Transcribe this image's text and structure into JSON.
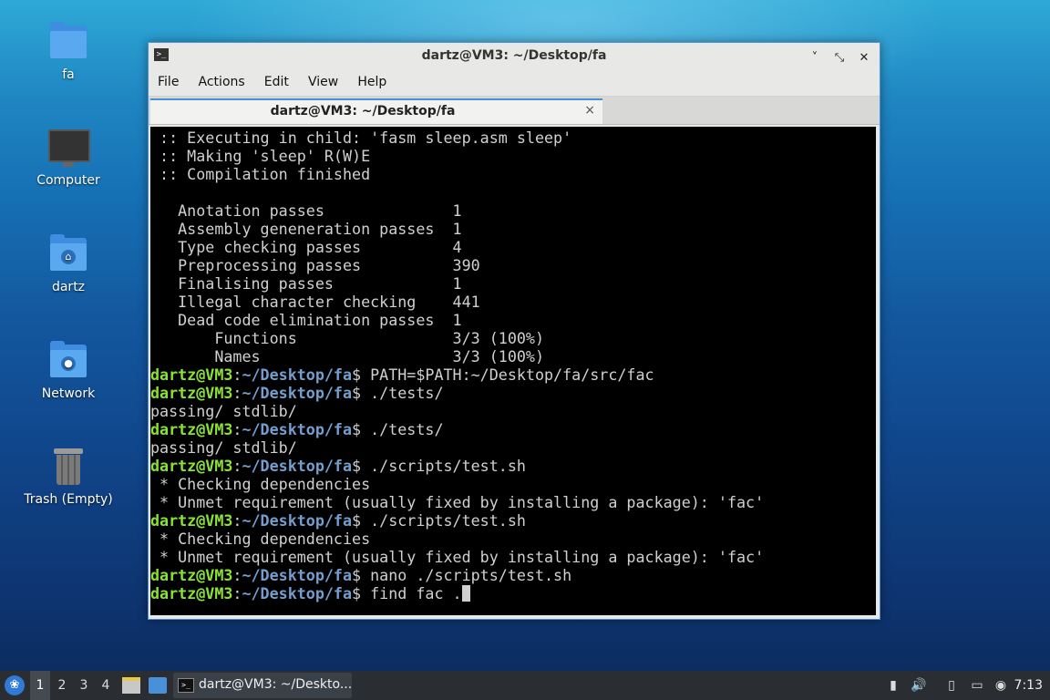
{
  "desktop": {
    "icons": [
      {
        "label": "fa",
        "icon": "folder-icon"
      },
      {
        "label": "Computer",
        "icon": "computer-icon"
      },
      {
        "label": "dartz",
        "icon": "home-folder-icon"
      },
      {
        "label": "Network",
        "icon": "network-folder-icon"
      },
      {
        "label": "Trash (Empty)",
        "icon": "trash-icon"
      }
    ]
  },
  "window": {
    "title": "dartz@VM3: ~/Desktop/fa",
    "menu": [
      "File",
      "Actions",
      "Edit",
      "View",
      "Help"
    ],
    "tab_label": "dartz@VM3: ~/Desktop/fa",
    "tab_close": "×",
    "buttons": {
      "minimize": "˅",
      "maximize": "⤡",
      "close": "✕"
    }
  },
  "terminal": {
    "prompt_user": "dartz@VM3",
    "prompt_sep": ":",
    "prompt_path": "~/Desktop/fa",
    "prompt_dollar": "$ ",
    "lines": [
      {
        "text": " :: Executing in child: 'fasm sleep.asm sleep'"
      },
      {
        "text": " :: Making 'sleep' R(W)E"
      },
      {
        "text": " :: Compilation finished"
      },
      {
        "text": ""
      },
      {
        "text": "   Anotation passes              1"
      },
      {
        "text": "   Assembly geneneration passes  1"
      },
      {
        "text": "   Type checking passes          4"
      },
      {
        "text": "   Preprocessing passes          390"
      },
      {
        "text": "   Finalising passes             1"
      },
      {
        "text": "   Illegal character checking    441"
      },
      {
        "text": "   Dead code elimination passes  1"
      },
      {
        "text": "       Functions                 3/3 (100%)"
      },
      {
        "text": "       Names                     3/3 (100%)"
      },
      {
        "cmd": "PATH=$PATH:~/Desktop/fa/src/fac"
      },
      {
        "cmd": "./tests/"
      },
      {
        "text": "passing/ stdlib/"
      },
      {
        "cmd": "./tests/"
      },
      {
        "text": "passing/ stdlib/"
      },
      {
        "cmd": "./scripts/test.sh"
      },
      {
        "text": " * Checking dependencies"
      },
      {
        "text": " * Unmet requirement (usually fixed by installing a package): 'fac'"
      },
      {
        "cmd": "./scripts/test.sh"
      },
      {
        "text": " * Checking dependencies"
      },
      {
        "text": " * Unmet requirement (usually fixed by installing a package): 'fac'"
      },
      {
        "cmd": "nano ./scripts/test.sh"
      },
      {
        "cmd": "find fac .",
        "current": true
      }
    ]
  },
  "taskbar": {
    "workspaces": [
      "1",
      "2",
      "3",
      "4"
    ],
    "active_workspace": "1",
    "task_label": "dartz@VM3: ~/Deskto...",
    "clock": "7:13",
    "tray_icons": [
      "clipboard-icon",
      "volume-icon",
      "notes-icon",
      "network-icon",
      "notification-icon"
    ]
  }
}
